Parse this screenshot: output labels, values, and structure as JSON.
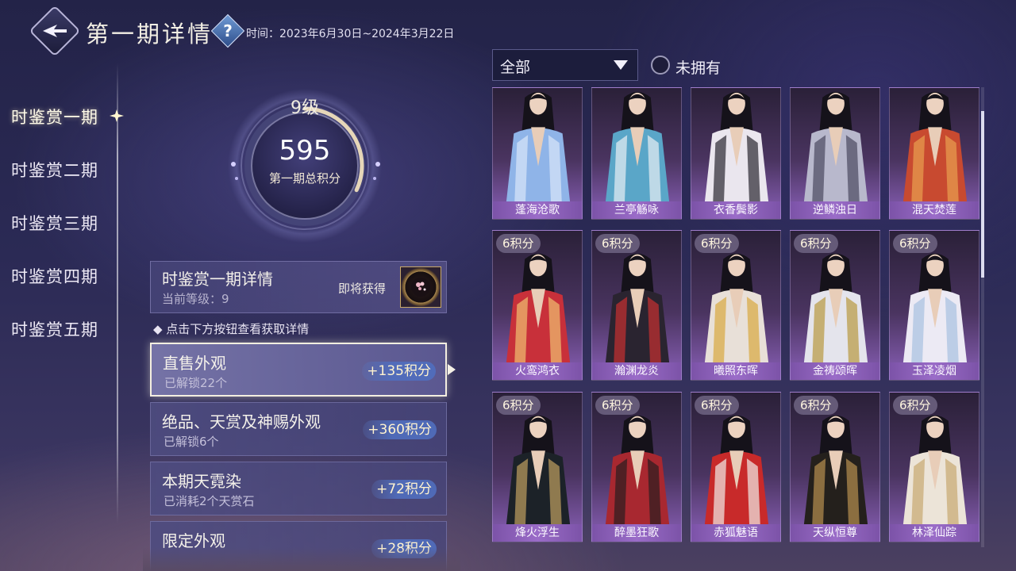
{
  "header": {
    "title": "第一期详情",
    "time_text": "时间：2023年6月30日~2024年3月22日"
  },
  "nav": {
    "items": [
      "时鉴赏一期",
      "时鉴赏二期",
      "时鉴赏三期",
      "时鉴赏四期",
      "时鉴赏五期"
    ],
    "active_index": 0
  },
  "score": {
    "level": "9级",
    "value": "595",
    "label": "第一期总积分",
    "progress": 0.32
  },
  "detail": {
    "title": "时鉴赏一期详情",
    "current_level": "当前等级：9",
    "soon_label": "即将获得",
    "hint": "◆ 点击下方按钮查看获取详情"
  },
  "categories": [
    {
      "title": "直售外观",
      "sub": "已解锁22个",
      "points": "+135积分"
    },
    {
      "title": "绝品、天赏及神赐外观",
      "sub": "已解锁6个",
      "points": "+360积分"
    },
    {
      "title": "本期天霓染",
      "sub": "已消耗2个天赏石",
      "points": "+72积分"
    },
    {
      "title": "限定外观",
      "sub": "",
      "points": "+28积分"
    }
  ],
  "filter": {
    "selected": "全部",
    "unowned_label": "未拥有"
  },
  "outfits": [
    {
      "name": "蓬海沧歌",
      "points": "",
      "robe": "#8fb4e8",
      "accent": "#d8e6fa"
    },
    {
      "name": "兰亭觞咏",
      "points": "",
      "robe": "#5aa6c8",
      "accent": "#e8f0f4"
    },
    {
      "name": "衣香鬓影",
      "points": "",
      "robe": "#eae6ee",
      "accent": "#2a2630"
    },
    {
      "name": "逆鳞浊日",
      "points": "",
      "robe": "#b8b8cc",
      "accent": "#4a4860"
    },
    {
      "name": "混天焚莲",
      "points": "",
      "robe": "#c84a30",
      "accent": "#e8a050"
    },
    {
      "name": "火鸾鸿衣",
      "points": "6积分",
      "robe": "#c8303a",
      "accent": "#f0c070"
    },
    {
      "name": "瀚渊龙炎",
      "points": "6积分",
      "robe": "#2a2430",
      "accent": "#c83030"
    },
    {
      "name": "曦照东晖",
      "points": "6积分",
      "robe": "#e8e0d8",
      "accent": "#d8a840"
    },
    {
      "name": "金祷颂晖",
      "points": "6积分",
      "robe": "#e4e4ec",
      "accent": "#b89840"
    },
    {
      "name": "玉泽凌烟",
      "points": "6积分",
      "robe": "#eceaf4",
      "accent": "#a8c0e0"
    },
    {
      "name": "烽火浮生",
      "points": "6积分",
      "robe": "#1c2228",
      "accent": "#c0a060"
    },
    {
      "name": "醉墨狂歌",
      "points": "6积分",
      "robe": "#a82830",
      "accent": "#2a1c20"
    },
    {
      "name": "赤狐魅语",
      "points": "6积分",
      "robe": "#c82a2a",
      "accent": "#f0ece8"
    },
    {
      "name": "天纵恒尊",
      "points": "6积分",
      "robe": "#24201c",
      "accent": "#b89050"
    },
    {
      "name": "林泽仙踪",
      "points": "6积分",
      "robe": "#ece4d8",
      "accent": "#c8a870"
    }
  ]
}
